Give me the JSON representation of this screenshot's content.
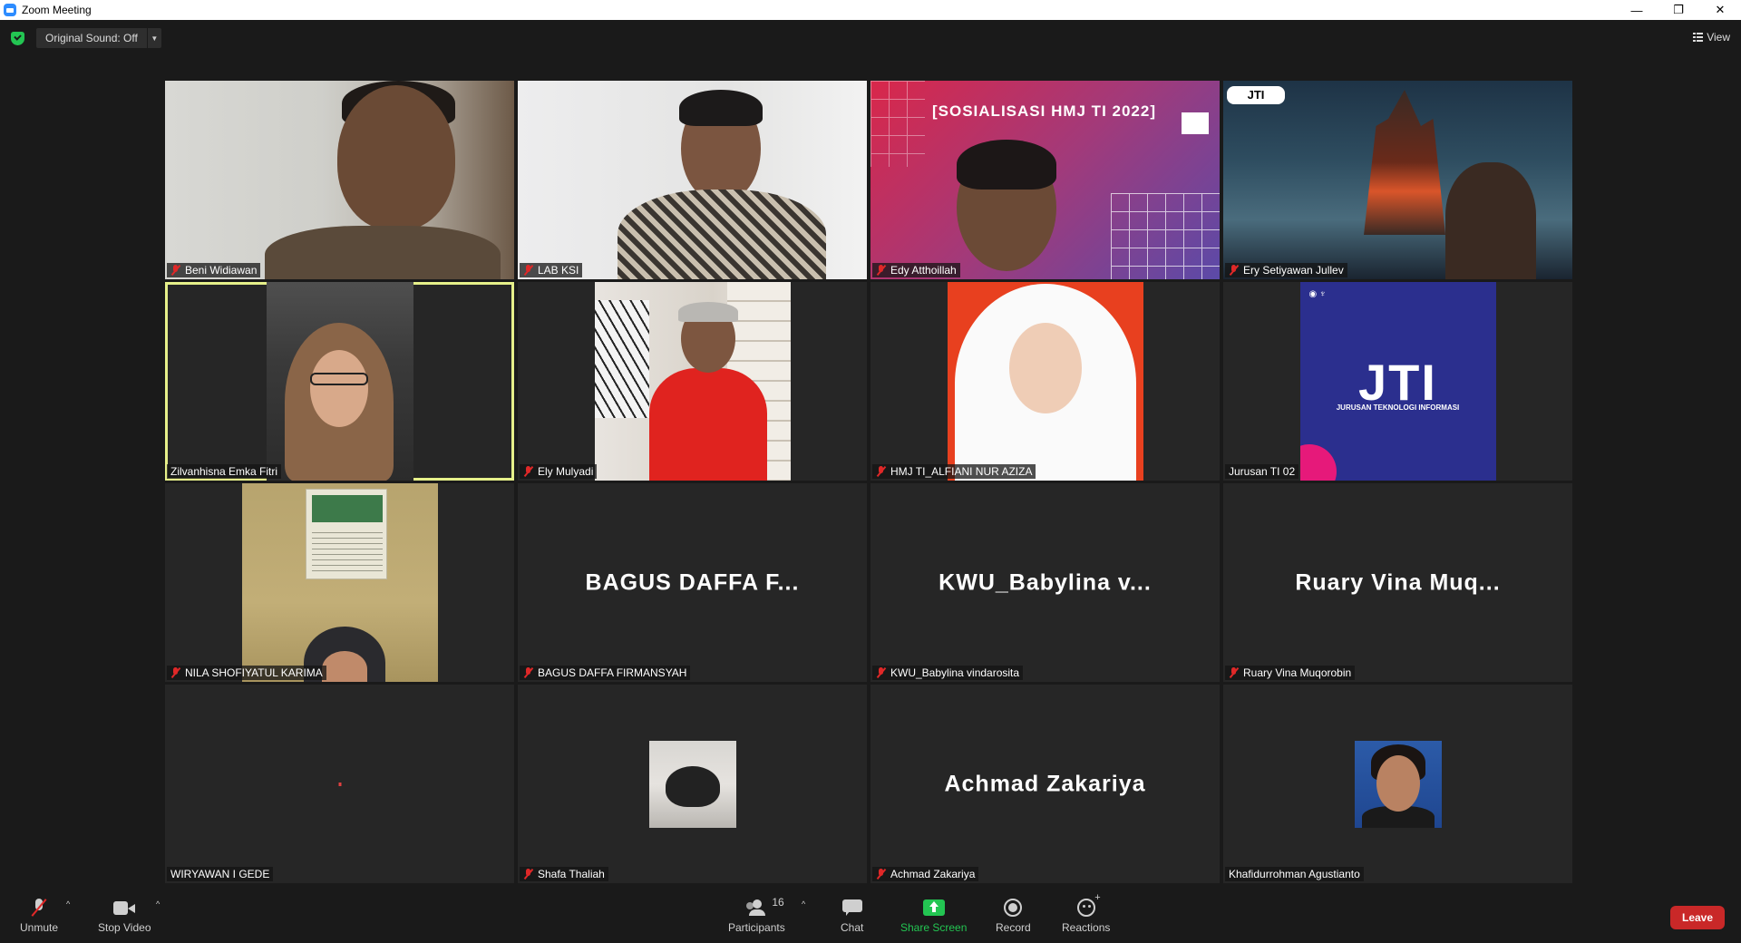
{
  "window": {
    "title": "Zoom Meeting",
    "buttons": {
      "minimize": "—",
      "restore": "❐",
      "close": "✕"
    }
  },
  "topbar": {
    "original_sound_label": "Original Sound: Off",
    "view_label": "View"
  },
  "tiles": [
    {
      "name": "Beni Widiawan",
      "muted": true
    },
    {
      "name": "LAB KSI",
      "muted": true
    },
    {
      "name": "Edy Atthoillah",
      "muted": true,
      "banner": "[SOSIALISASI HMJ TI 2022]"
    },
    {
      "name": "Ery Setiyawan Jullev",
      "muted": true,
      "badge": "JTI"
    },
    {
      "name": "Zilvanhisna Emka Fitri",
      "muted": false,
      "active_speaker": true
    },
    {
      "name": "Ely Mulyadi",
      "muted": true
    },
    {
      "name": "HMJ TI_ALFIANI NUR AZIZA",
      "muted": true
    },
    {
      "name": "Jurusan TI 02",
      "muted": false,
      "logo_text": "JTI",
      "logo_sub": "JURUSAN TEKNOLOGI INFORMASI"
    },
    {
      "name": "NILA SHOFIYATUL KARIMA",
      "muted": true
    },
    {
      "name": "BAGUS DAFFA FIRMANSYAH",
      "muted": true,
      "display_name": "BAGUS DAFFA F..."
    },
    {
      "name": "KWU_Babylina vindarosita",
      "muted": true,
      "display_name": "KWU_Babylina v..."
    },
    {
      "name": "Ruary Vina Muqorobin",
      "muted": true,
      "display_name": "Ruary Vina Muq..."
    },
    {
      "name": "WIRYAWAN I GEDE",
      "muted": false
    },
    {
      "name": "Shafa Thaliah",
      "muted": true
    },
    {
      "name": "Achmad Zakariya",
      "muted": true,
      "display_name": "Achmad Zakariya"
    },
    {
      "name": "Khafidurrohman Agustianto",
      "muted": false
    }
  ],
  "toolbar": {
    "unmute_label": "Unmute",
    "stop_video_label": "Stop Video",
    "participants_label": "Participants",
    "participants_count": "16",
    "chat_label": "Chat",
    "share_screen_label": "Share Screen",
    "record_label": "Record",
    "reactions_label": "Reactions",
    "leave_label": "Leave",
    "caret": "^"
  },
  "colors": {
    "background": "#1a1a1a",
    "tile": "#262626",
    "active_speaker_border": "#e6f08a",
    "muted_red": "#e02828",
    "share_green": "#23c552",
    "leave_red": "#c92828"
  }
}
